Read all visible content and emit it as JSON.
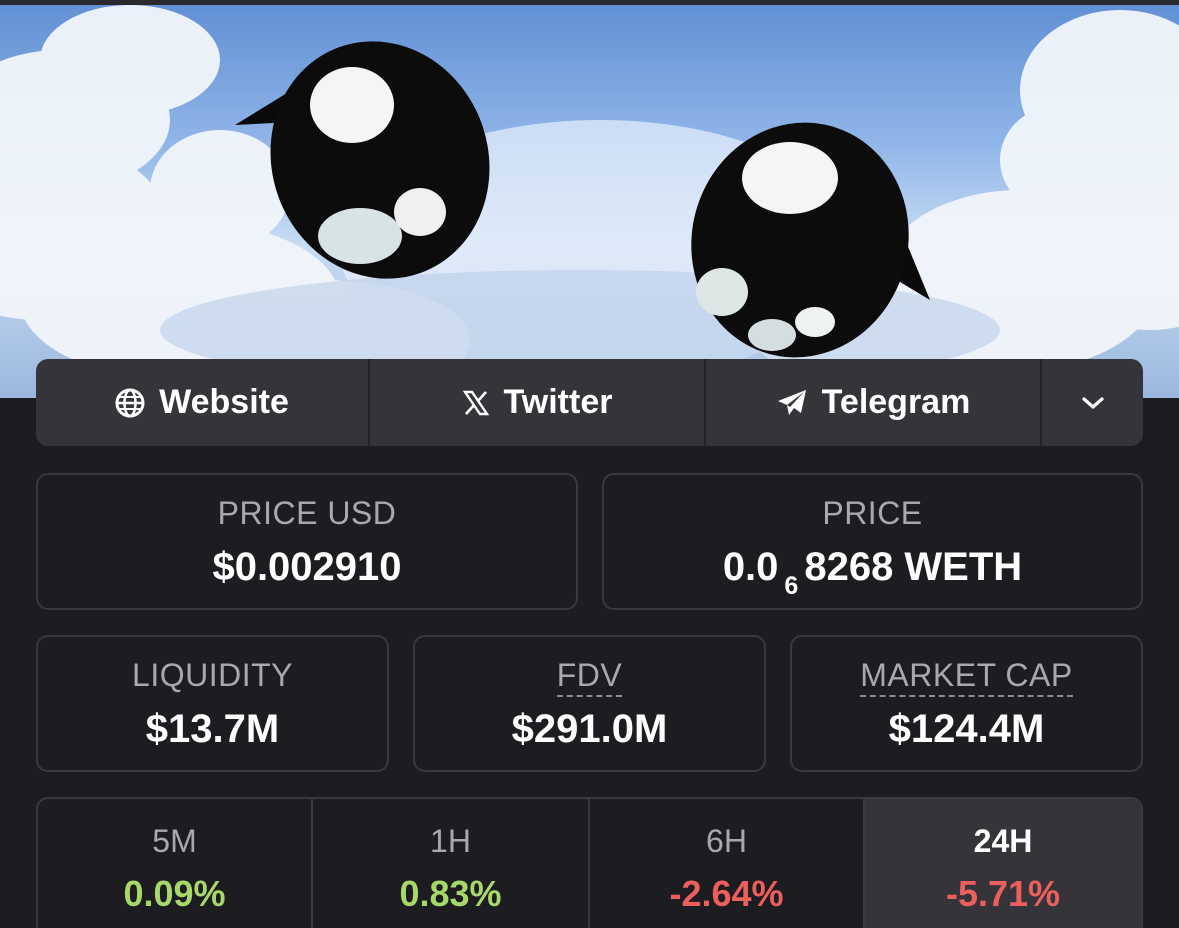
{
  "colors": {
    "background": "#1d1c21",
    "panel": "#35343b",
    "border": "#3a3940",
    "label": "#a9a8b1",
    "positive": "#a7d86a",
    "negative": "#ec5f5d"
  },
  "banner": {
    "image": "cartoon-orcas-in-cloudy-sky"
  },
  "social": {
    "website": {
      "label": "Website",
      "icon": "globe-icon"
    },
    "twitter": {
      "label": "Twitter",
      "icon": "x-logo-icon"
    },
    "telegram": {
      "label": "Telegram",
      "icon": "paper-plane-icon"
    },
    "more": {
      "icon": "chevron-down-icon"
    }
  },
  "stats": {
    "price_usd": {
      "label": "PRICE USD",
      "value": "$0.002910"
    },
    "price": {
      "label": "PRICE",
      "value_prefix": "0.0",
      "value_subscript": "6",
      "value_rest": "8268 WETH"
    },
    "liquidity": {
      "label": "LIQUIDITY",
      "value": "$13.7M"
    },
    "fdv": {
      "label": "FDV",
      "value": "$291.0M"
    },
    "market_cap": {
      "label": "MARKET CAP",
      "value": "$124.4M"
    }
  },
  "timeframes": [
    {
      "label": "5M",
      "value": "0.09%",
      "trend": "positive"
    },
    {
      "label": "1H",
      "value": "0.83%",
      "trend": "positive"
    },
    {
      "label": "6H",
      "value": "-2.64%",
      "trend": "negative"
    },
    {
      "label": "24H",
      "value": "-5.71%",
      "trend": "negative",
      "selected": true
    }
  ]
}
